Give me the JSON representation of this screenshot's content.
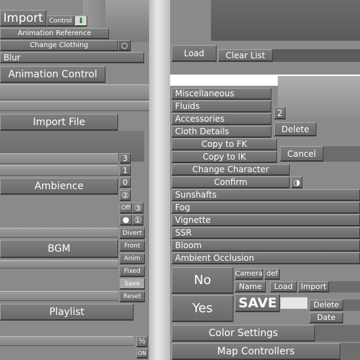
{
  "left": {
    "import_label": "Import",
    "control_label": "Control",
    "animation_reference": "Animation Reference",
    "change_clothing": "Change Clothing",
    "blur": "Blur",
    "animation_control": "Animation Control",
    "import_file": "Import File",
    "numbers": [
      "3",
      "1",
      "0"
    ],
    "ambience": "Ambience",
    "symbol_2": "②",
    "off": "Off",
    "symbol_3": "③",
    "symbol_1": "①",
    "bgm": "BGM",
    "bgm_buttons": [
      "Divert",
      "Front",
      "Anim",
      "Fixed",
      "Save",
      "Reset"
    ],
    "playlist": "Playlist",
    "half": "½",
    "on": "ON"
  },
  "right": {
    "load": "Load",
    "clear_list": "Clear List",
    "categories": [
      "Miscellaneous",
      "Fluids",
      "Accessories",
      "Cloth Details"
    ],
    "count": "2",
    "delete": "Delete",
    "copy_to_fk": "Copy to FK",
    "copy_to_ik": "Copy to IK",
    "cancel": "Cancel",
    "change_character": "Change Character",
    "confirm": "Confirm",
    "effects": [
      "Sunshafts",
      "Fog",
      "Vignette",
      "SSR",
      "Bloom",
      "Ambient Occlusion"
    ],
    "no": "No",
    "yes": "Yes",
    "camera": "Camera",
    "def": "def",
    "name": "Name",
    "load_small": "Load",
    "import_small": "Import",
    "save": "SAVE",
    "delete_small": "Delete",
    "date": "Date",
    "color_settings": "Color Settings",
    "map_controllers": "Map Controllers"
  }
}
